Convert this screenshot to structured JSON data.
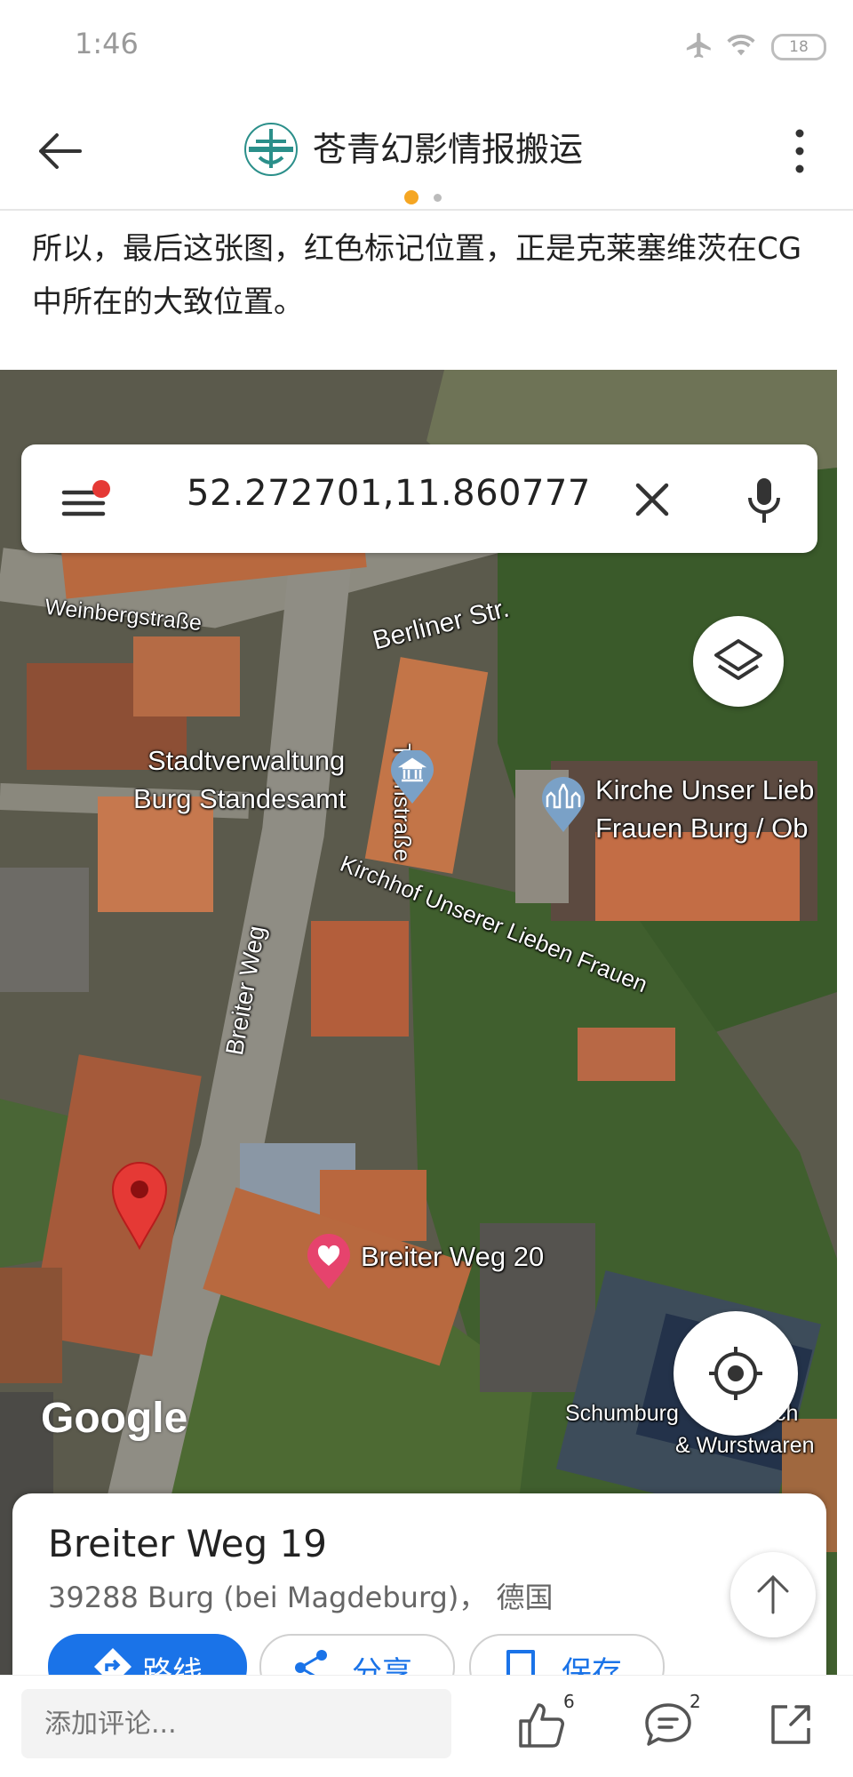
{
  "status_bar": {
    "time": "1:46",
    "battery": "18",
    "icons": [
      "airplane-mode-icon",
      "wifi-icon",
      "battery-icon"
    ]
  },
  "header": {
    "title": "苍青幻影情报搬运",
    "back_icon": "back-arrow-icon",
    "more_icon": "more-vertical-icon",
    "logo": "account-logo"
  },
  "article": {
    "text": "所以，最后这张图，红色标记位置，正是克莱塞维茨在CG中所在的大致位置。"
  },
  "map": {
    "search_query": "52.272701,11.860777",
    "labels": {
      "weinberg": "Weinbergstraße",
      "berliner": "Berliner Str.",
      "turm": "Turmstraße",
      "stadt1": "Stadtverwaltung",
      "stadt2": "Burg Standesamt",
      "kirche1": "Kirche Unser Lieb",
      "kirche2": "Frauen Burg / Ob",
      "kirchhof": "Kirchhof Unserer Lieben Frauen",
      "breiter": "Breiter Weg",
      "breiter20": "Breiter Weg 20",
      "schumburg1": "Schumburg",
      "schumburg2": "ch",
      "wurst": "& Wurstwaren",
      "google": "Google"
    },
    "colors": {
      "pin": "#e53935",
      "accent": "#1a73e8",
      "notification_dot": "#e53935"
    }
  },
  "place_card": {
    "name": "Breiter Weg 19",
    "address": "39288 Burg (bei Magdeburg)，  德国",
    "actions": {
      "route": "路线",
      "share": "分享",
      "save": "保存"
    }
  },
  "bottom_bar": {
    "comment_placeholder": "添加评论...",
    "like_count": "6",
    "comment_count": "2"
  }
}
